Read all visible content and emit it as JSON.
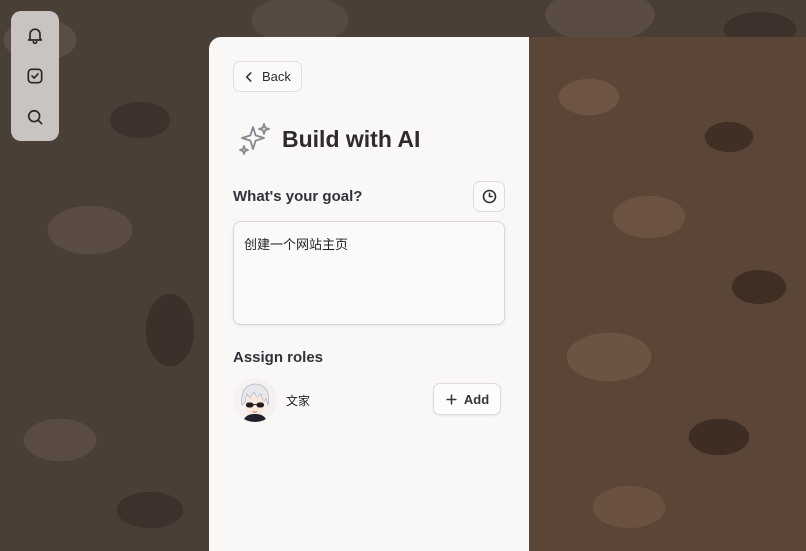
{
  "dock": {
    "items": [
      {
        "icon": "bell-icon"
      },
      {
        "icon": "check-square-icon"
      },
      {
        "icon": "search-icon"
      }
    ]
  },
  "panel": {
    "back_label": "Back",
    "title": "Build with AI",
    "goal_label": "What's your goal?",
    "goal_value": "创建一个网站主页",
    "roles_label": "Assign roles",
    "roles": [
      {
        "name": "文家"
      }
    ],
    "add_label": "Add"
  },
  "colors": {
    "panel_bg": "#faf7f7",
    "title_text": "#2e2a2f",
    "dock_bg": "#c9c4c2"
  }
}
